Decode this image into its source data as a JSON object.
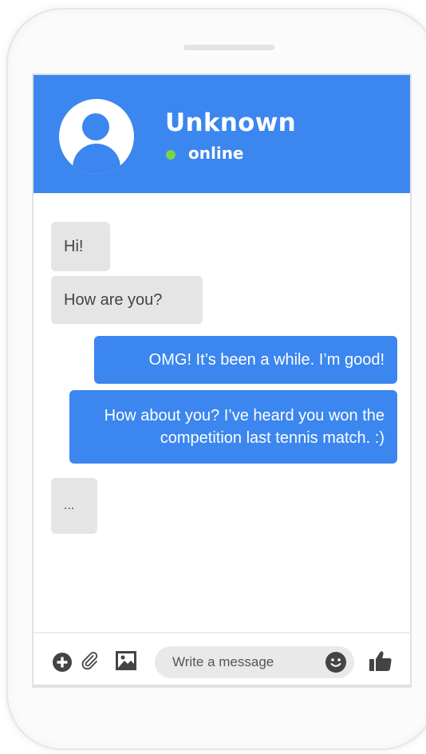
{
  "header": {
    "contact_name": "Unknown",
    "status": "online"
  },
  "messages": [
    {
      "direction": "incoming",
      "text": "Hi!"
    },
    {
      "direction": "incoming",
      "text": "How are you?"
    },
    {
      "direction": "outgoing",
      "text": "OMG! It’s been a while. I’m good!"
    },
    {
      "direction": "outgoing",
      "text": "How about you? I’ve heard you won the competition last tennis match. :)"
    },
    {
      "direction": "incoming",
      "text": "..."
    }
  ],
  "composer": {
    "placeholder": "Write a message",
    "icons": [
      "plus-icon",
      "paperclip-icon",
      "image-icon",
      "emoji-icon",
      "thumbs-up-icon"
    ]
  },
  "colors": {
    "accent": "#3b86ef",
    "online": "#7bd34a",
    "incoming_bubble": "#e5e5e5"
  }
}
